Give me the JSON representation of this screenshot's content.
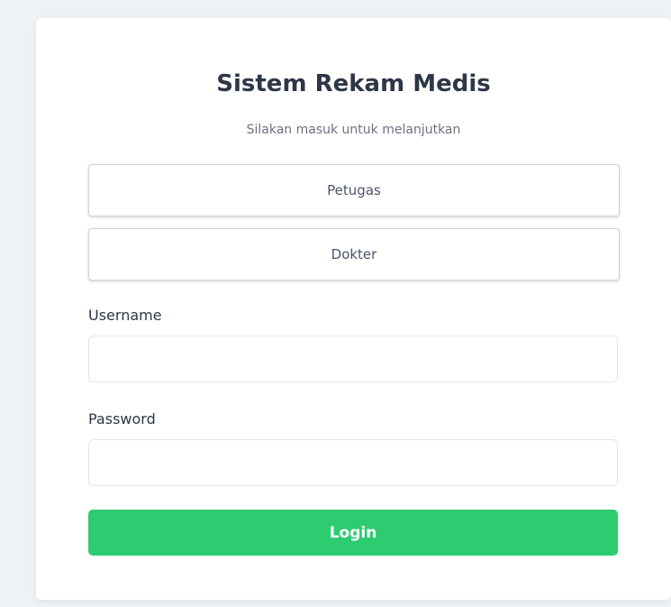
{
  "header": {
    "title": "Sistem Rekam Medis",
    "subtitle": "Silakan masuk untuk melanjutkan"
  },
  "roles": {
    "petugas_label": "Petugas",
    "dokter_label": "Dokter"
  },
  "form": {
    "username_label": "Username",
    "username_value": "",
    "password_label": "Password",
    "password_value": "",
    "login_label": "Login"
  },
  "colors": {
    "login_button": "#2ecc71",
    "title_text": "#2d3748",
    "background": "#eef1f5"
  }
}
